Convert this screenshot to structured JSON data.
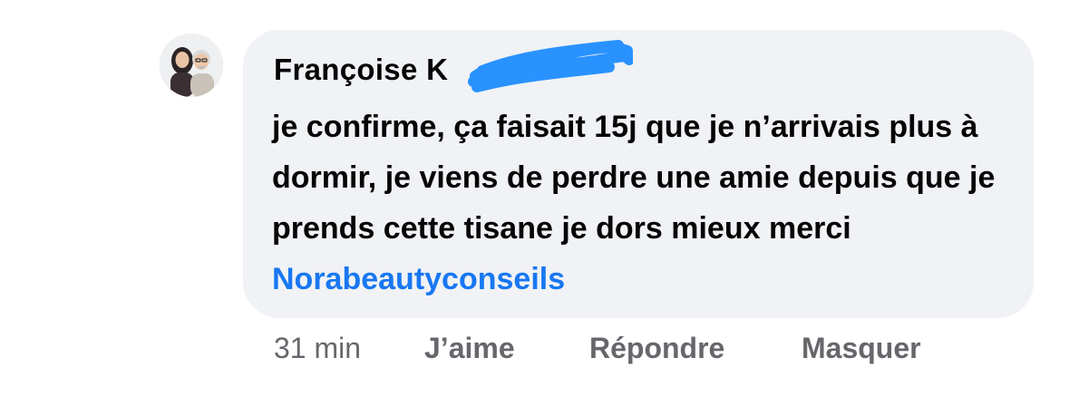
{
  "comment": {
    "author": "Françoise K",
    "text": "je confirme, ça faisait 15j que je n’arrivais plus à dormir, je viens de perdre une amie depuis que je prends cette tisane je dors mieux merci",
    "mention": "Norabeautyconseils",
    "mention_color": "#1877f2",
    "bubble_color": "#f0f2f5"
  },
  "actions": {
    "time": "31 min",
    "like": "J’aime",
    "reply": "Répondre",
    "hide": "Masquer"
  }
}
